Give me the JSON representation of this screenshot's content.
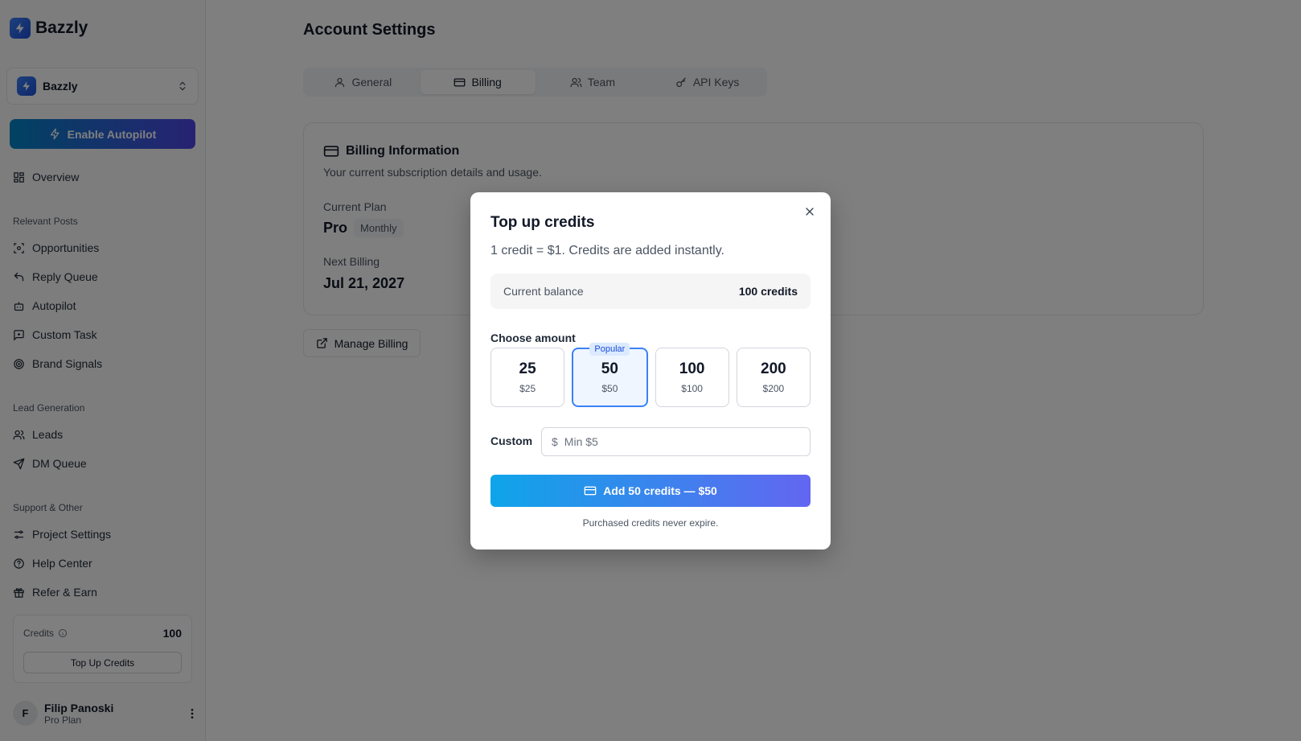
{
  "app": {
    "name": "Bazzly"
  },
  "sidebar": {
    "project": {
      "name": "Bazzly"
    },
    "autopilot_label": "Enable Autopilot",
    "overview_label": "Overview",
    "sections": {
      "relevant_posts": "Relevant Posts",
      "lead_generation": "Lead Generation",
      "support": "Support & Other"
    },
    "relevant_posts_items": [
      "Opportunities",
      "Reply Queue",
      "Autopilot",
      "Custom Task",
      "Brand Signals"
    ],
    "lead_generation_items": [
      "Leads",
      "DM Queue"
    ],
    "support_items": [
      "Project Settings",
      "Help Center",
      "Refer & Earn"
    ],
    "credits": {
      "label": "Credits",
      "value": "100",
      "button": "Top Up Credits"
    },
    "user": {
      "initial": "F",
      "name": "Filip Panoski",
      "plan": "Pro Plan"
    }
  },
  "main": {
    "title": "Account Settings",
    "tabs": [
      "General",
      "Billing",
      "Team",
      "API Keys"
    ],
    "active_tab": "Billing",
    "billing": {
      "title": "Billing Information",
      "subtitle": "Your current subscription details and usage.",
      "current_plan_label": "Current Plan",
      "plan_name": "Pro",
      "plan_cycle": "Monthly",
      "next_billing_label": "Next Billing",
      "next_billing_date": "Jul 21, 2027"
    },
    "manage_billing": "Manage Billing"
  },
  "modal": {
    "title": "Top up credits",
    "subtitle": "1 credit = $1. Credits are added instantly.",
    "balance_label": "Current balance",
    "balance_value": "100 credits",
    "choose_label": "Choose amount",
    "options": [
      {
        "credits": "25",
        "price": "$25"
      },
      {
        "credits": "50",
        "price": "$50",
        "badge": "Popular"
      },
      {
        "credits": "100",
        "price": "$100"
      },
      {
        "credits": "200",
        "price": "$200"
      }
    ],
    "selected_option": "50",
    "custom_label": "Custom",
    "custom_prefix": "$",
    "custom_placeholder": "Min $5",
    "submit_label": "Add 50 credits — $50",
    "footnote": "Purchased credits never expire."
  },
  "colors": {
    "accent": "#3b82f6",
    "gradient_start": "#0ea5e9",
    "gradient_end": "#6366f1"
  }
}
